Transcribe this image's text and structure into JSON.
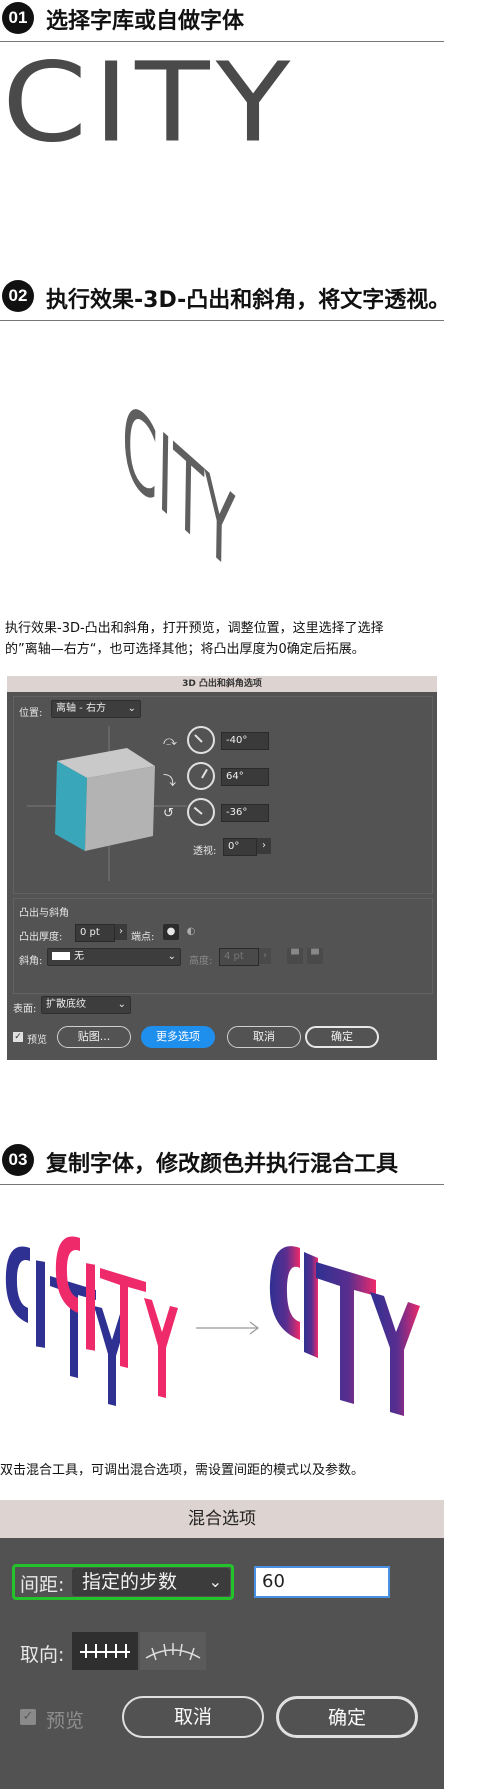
{
  "step1": {
    "num": "01",
    "heading": "选择字库或自做字体",
    "word": "CITY"
  },
  "step2": {
    "num": "02",
    "heading": "执行效果-3D-凸出和斜角，将文字透视。",
    "word": "CITY",
    "desc_line1": "执行效果-3D-凸出和斜角，打开预览，调整位置，这里选择了选择",
    "desc_line2": "的”离轴—右方“，也可选择其他；将凸出厚度为0确定后拓展。"
  },
  "dialog3d": {
    "title": "3D 凸出和斜角选项",
    "position_label": "位置:",
    "position_value": "离轴 - 右方",
    "rot_x": "-40°",
    "rot_y": "64°",
    "rot_z": "-36°",
    "perspective_label": "透视:",
    "perspective_value": "0°",
    "extrude_section": "凸出与斜角",
    "depth_label": "凸出厚度:",
    "depth_value": "0 pt",
    "cap_label": "端点:",
    "bevel_label": "斜角:",
    "bevel_value": "无",
    "height_label": "高度:",
    "height_value": "4 pt",
    "surface_label": "表面:",
    "surface_value": "扩散底纹",
    "preview_label": "预览",
    "map_button": "贴图...",
    "more_button": "更多选项",
    "cancel_button": "取消",
    "ok_button": "确定",
    "colors": {
      "cube_front": "#b4b4b4",
      "cube_top": "#c8c8c8",
      "cube_side": "#3aa6b9",
      "accent": "#1f8fee"
    }
  },
  "step3": {
    "num": "03",
    "heading": "复制字体，修改颜色并执行混合工具",
    "desc": "双击混合工具，可调出混合选项，需设置间距的模式以及参数。",
    "colors": {
      "blue": "#2e3192",
      "pink": "#ee2a6b"
    }
  },
  "blend_dialog": {
    "title": "混合选项",
    "spacing_label": "间距:",
    "spacing_value": "指定的步数",
    "steps_value": "60",
    "orient_label": "取向:",
    "preview_label": "预览",
    "cancel_button": "取消",
    "ok_button": "确定",
    "colors": {
      "highlight": "#22c32b",
      "field_border": "#4a90e2"
    }
  }
}
